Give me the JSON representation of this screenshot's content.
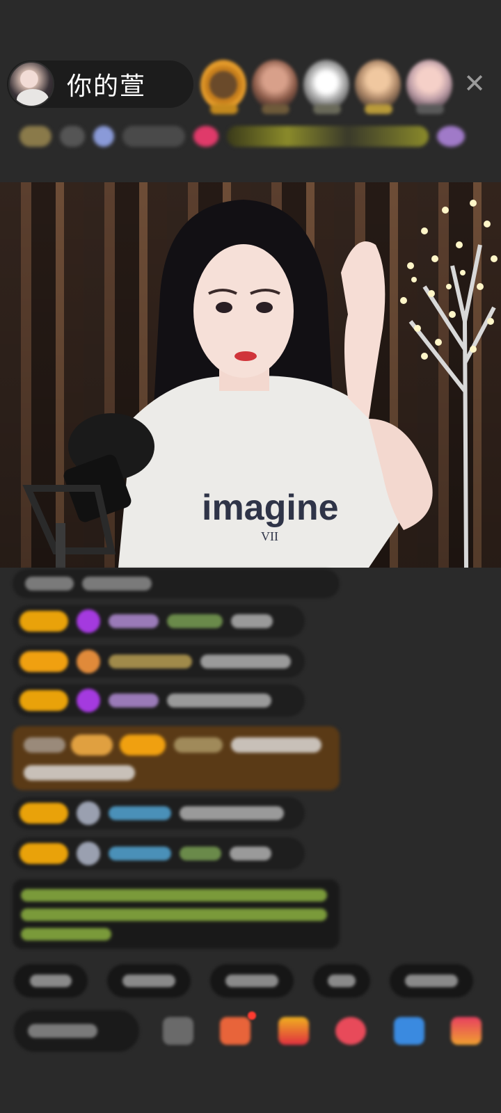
{
  "host": {
    "name": "你的萱"
  },
  "top_bar": {
    "close_icon": "close-icon",
    "viewer_count": 5
  },
  "video": {
    "shirt_text": "imagine",
    "shirt_sub": "VII"
  },
  "colors": {
    "background": "#2a2a2a",
    "pill": "#1c1c1c",
    "level_badge": "#e9a20a",
    "highlight_message": "#5a3a16",
    "notification_dot": "#ff3b30"
  }
}
